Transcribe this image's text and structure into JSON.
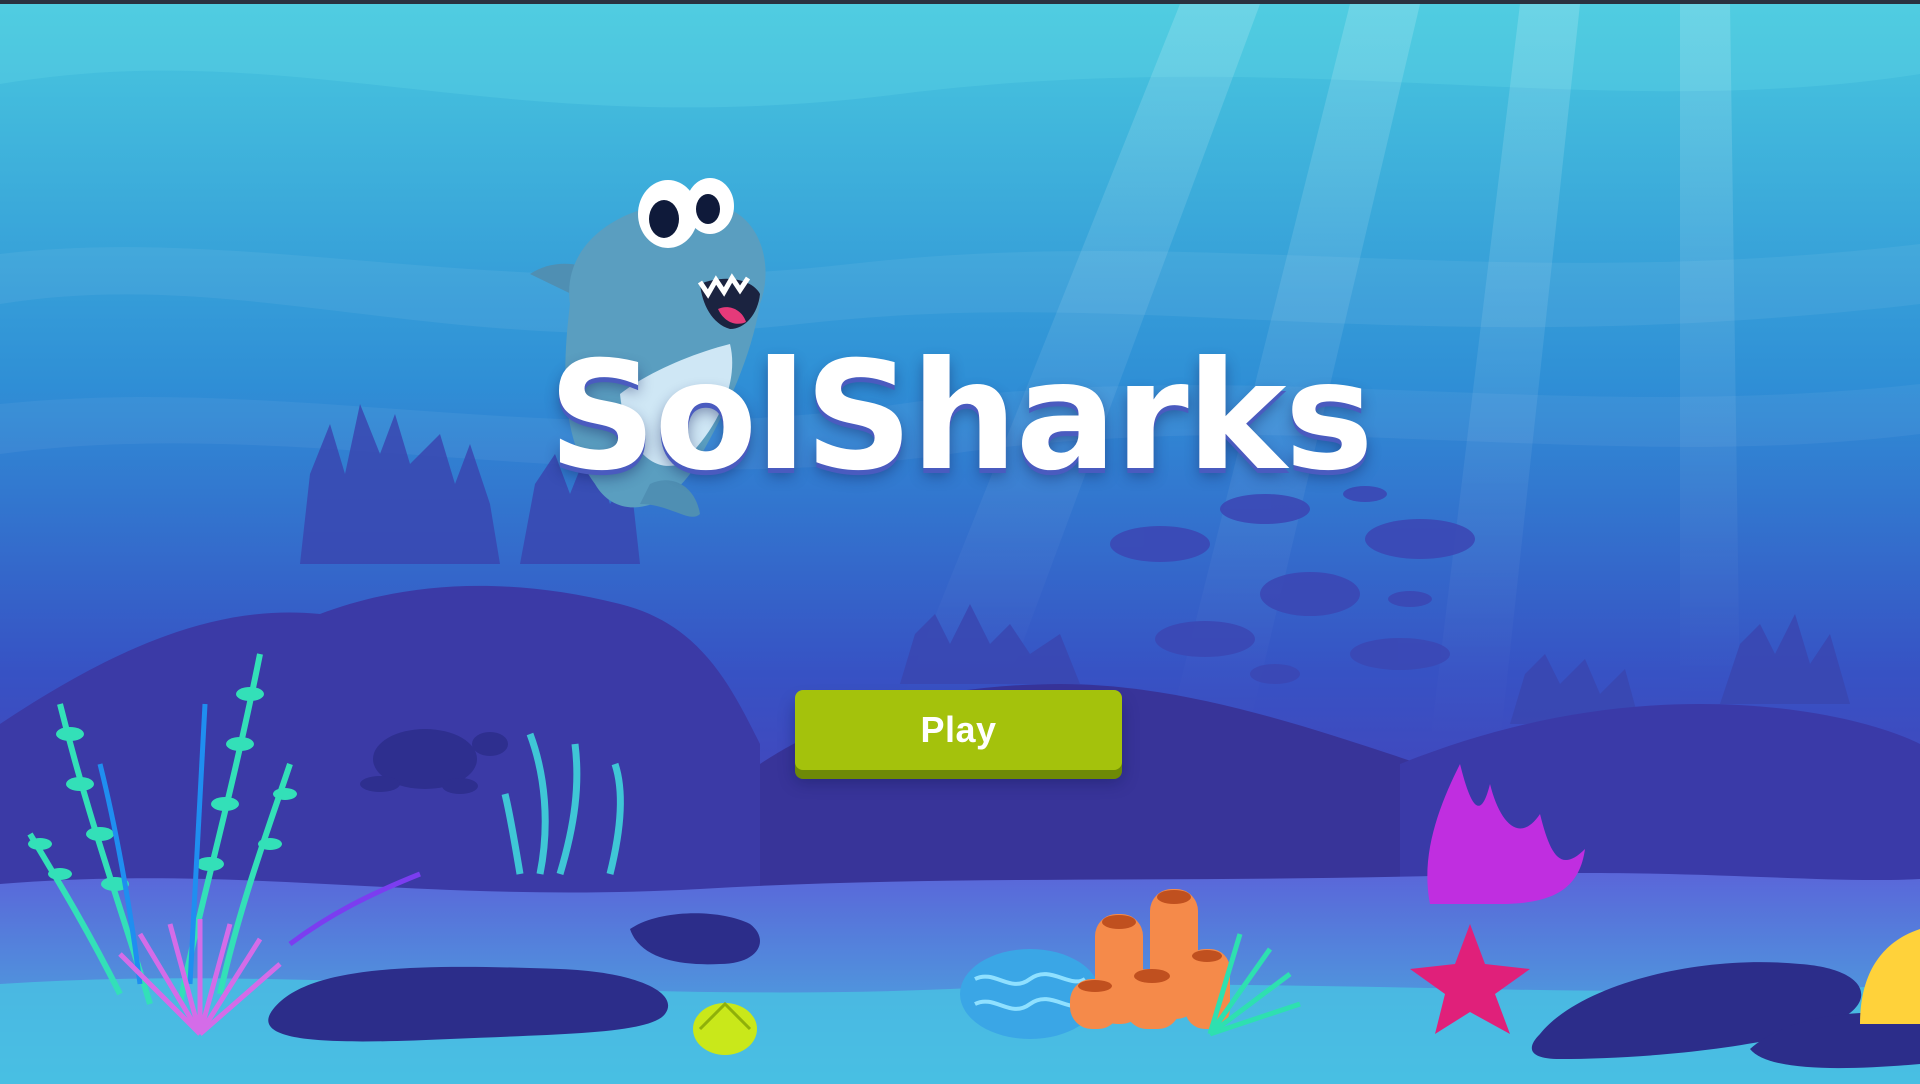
{
  "game": {
    "title": "SolSharks",
    "play_label": "Play"
  },
  "colors": {
    "water_top": "#49c9df",
    "water_mid": "#2f7fd0",
    "water_deep": "#3b3bb0",
    "seafloor": "#5a64d8",
    "play_button": "#a4c20c",
    "title_text": "#ffffff"
  },
  "icons": {
    "mascot": "cartoon-shark-mascot",
    "decor": [
      "seaweed",
      "coral",
      "sea-turtle",
      "fish-school",
      "starfish",
      "shell",
      "sea-cucumber",
      "brain-coral"
    ]
  }
}
